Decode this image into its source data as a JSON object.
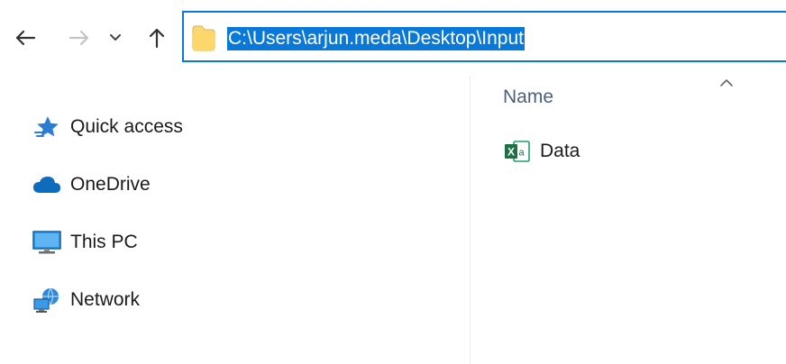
{
  "address_bar": {
    "path": "C:\\Users\\arjun.meda\\Desktop\\Input"
  },
  "navigation_pane": {
    "items": [
      {
        "label": "Quick access",
        "icon": "star-icon"
      },
      {
        "label": "OneDrive",
        "icon": "cloud-icon"
      },
      {
        "label": "This PC",
        "icon": "monitor-icon"
      },
      {
        "label": "Network",
        "icon": "network-icon"
      }
    ]
  },
  "file_list": {
    "column_header": "Name",
    "sort_indicator": "ascending",
    "files": [
      {
        "name": "Data",
        "icon": "excel-file-icon"
      }
    ]
  },
  "colors": {
    "accent": "#0a78d7",
    "folder": "#f8d775",
    "excel_green": "#1e7145",
    "cloud_blue": "#0f6cbd",
    "header_text": "#4c607a"
  }
}
